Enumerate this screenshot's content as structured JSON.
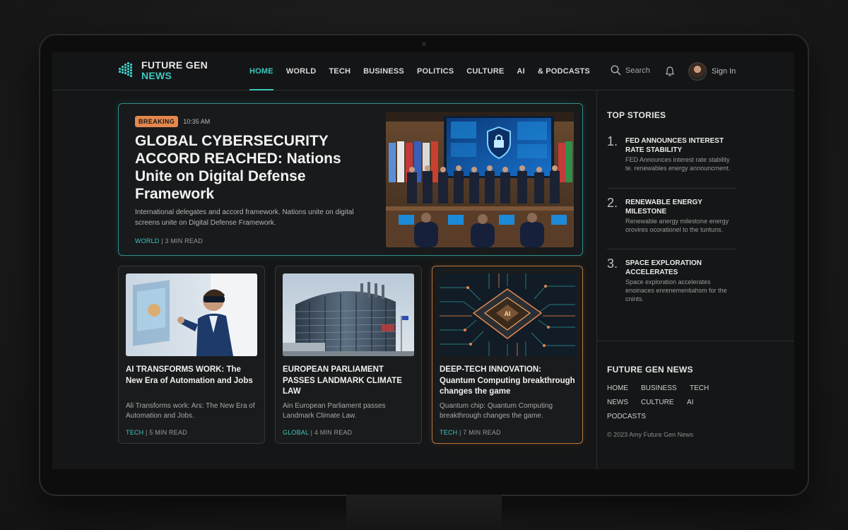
{
  "brand": {
    "line1": "FUTURE GEN",
    "line2": "NEWS"
  },
  "nav": [
    {
      "label": "HOME",
      "active": true
    },
    {
      "label": "WORLD",
      "active": false
    },
    {
      "label": "TECH",
      "active": false
    },
    {
      "label": "BUSINESS",
      "active": false
    },
    {
      "label": "POLITICS",
      "active": false
    },
    {
      "label": "CULTURE",
      "active": false
    },
    {
      "label": "AI",
      "active": false
    },
    {
      "label": "& PODCASTS",
      "active": false
    }
  ],
  "header": {
    "search_label": "Search",
    "signin_label": "Sign In"
  },
  "hero": {
    "badge": "BREAKING",
    "time": "10:35 AM",
    "title": "GLOBAL CYBERSECURITY ACCORD REACHED: Nations Unite on Digital Defense Framework",
    "description": "International delegates and accord framework. Nations unite on digital screens unite on Digital Defense Framework.",
    "category": "WORLD",
    "read_time": "3 MIN READ"
  },
  "cards": [
    {
      "title": "AI TRANSFORMS WORK: The New Era of Automation and Jobs",
      "description": "Ali Transforms work: Ars: The New Era of Automation and Jobs.",
      "category": "TECH",
      "read_time": "5 MIN READ"
    },
    {
      "title": "EUROPEAN PARLIAMENT PASSES LANDMARK CLIMATE LAW",
      "description": "Ain European Parliament passes Landmark Climate Law.",
      "category": "GLOBAL",
      "read_time": "4 MIN READ"
    },
    {
      "title": "DEEP-TECH INNOVATION: Quantum Computing breakthrough changes the game",
      "description": "Quantum chip: Quantum Computing breakthrough changes the game.",
      "category": "TECH",
      "read_time": "7 MIN READ"
    }
  ],
  "top_stories": {
    "heading": "TOP STORIES",
    "items": [
      {
        "num": "1.",
        "title": "FED ANNOUNCES INTEREST RATE STABILITY",
        "description": "FED Announces interest rate stability te. renewables energy announcment."
      },
      {
        "num": "2.",
        "title": "RENEWABLE ENERGY MILESTONE",
        "description": "Renewable anergy milestone energy orovires ocorationel to the tuntuns."
      },
      {
        "num": "3.",
        "title": "SPACE EXPLORATION ACCELERATES",
        "description": "Space exploration accelerates enoinaces enrenementiahsm for the cnints."
      }
    ]
  },
  "footer": {
    "heading": "FUTURE GEN NEWS",
    "links": [
      "HOME",
      "BUSINESS",
      "TECH",
      "NEWS",
      "CULTURE",
      "AI",
      "PODCASTS"
    ],
    "copyright": "© 2023 Amy Future Gen News"
  },
  "colors": {
    "accent": "#3fc7c0",
    "breaking": "#e5874d",
    "highlight_border": "#b8773d",
    "background": "#151617"
  }
}
